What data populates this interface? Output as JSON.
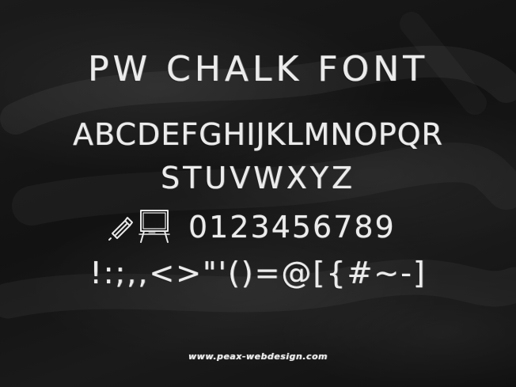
{
  "title": "PW CHALK FONT",
  "uppercase_row_1": "ABCDEFGHIJKLMNOPQR",
  "uppercase_row_2": "STUVWXYZ",
  "digits": "0123456789",
  "symbols": "!:;,,<>\"'()=@[{#~-]",
  "website": "www.peax-webdesign.com",
  "icons": [
    "chalk-stick-icon",
    "chalkboard-easel-icon"
  ],
  "colors": {
    "background": "#141414",
    "chalk": "#ececec"
  }
}
